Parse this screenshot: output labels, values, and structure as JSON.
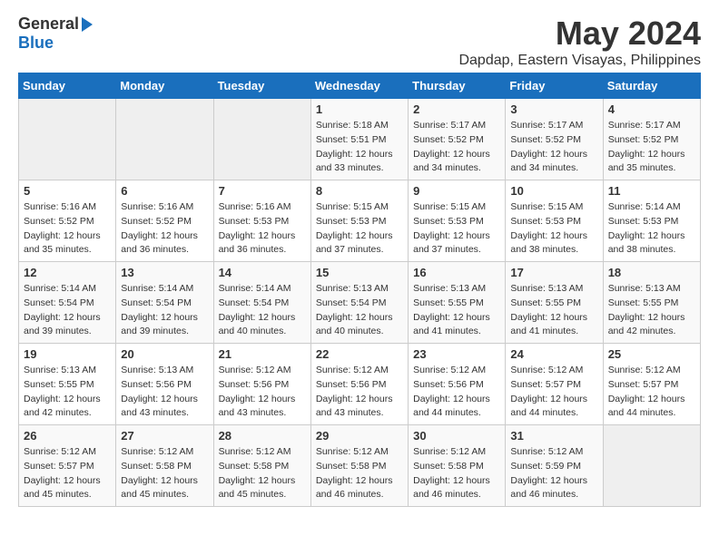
{
  "header": {
    "logo_general": "General",
    "logo_blue": "Blue",
    "title": "May 2024",
    "subtitle": "Dapdap, Eastern Visayas, Philippines"
  },
  "calendar": {
    "weekdays": [
      "Sunday",
      "Monday",
      "Tuesday",
      "Wednesday",
      "Thursday",
      "Friday",
      "Saturday"
    ],
    "weeks": [
      [
        {
          "day": "",
          "empty": true
        },
        {
          "day": "",
          "empty": true
        },
        {
          "day": "",
          "empty": true
        },
        {
          "day": "1",
          "sunrise": "5:18 AM",
          "sunset": "5:51 PM",
          "daylight": "12 hours and 33 minutes."
        },
        {
          "day": "2",
          "sunrise": "5:17 AM",
          "sunset": "5:52 PM",
          "daylight": "12 hours and 34 minutes."
        },
        {
          "day": "3",
          "sunrise": "5:17 AM",
          "sunset": "5:52 PM",
          "daylight": "12 hours and 34 minutes."
        },
        {
          "day": "4",
          "sunrise": "5:17 AM",
          "sunset": "5:52 PM",
          "daylight": "12 hours and 35 minutes."
        }
      ],
      [
        {
          "day": "5",
          "sunrise": "5:16 AM",
          "sunset": "5:52 PM",
          "daylight": "12 hours and 35 minutes."
        },
        {
          "day": "6",
          "sunrise": "5:16 AM",
          "sunset": "5:52 PM",
          "daylight": "12 hours and 36 minutes."
        },
        {
          "day": "7",
          "sunrise": "5:16 AM",
          "sunset": "5:53 PM",
          "daylight": "12 hours and 36 minutes."
        },
        {
          "day": "8",
          "sunrise": "5:15 AM",
          "sunset": "5:53 PM",
          "daylight": "12 hours and 37 minutes."
        },
        {
          "day": "9",
          "sunrise": "5:15 AM",
          "sunset": "5:53 PM",
          "daylight": "12 hours and 37 minutes."
        },
        {
          "day": "10",
          "sunrise": "5:15 AM",
          "sunset": "5:53 PM",
          "daylight": "12 hours and 38 minutes."
        },
        {
          "day": "11",
          "sunrise": "5:14 AM",
          "sunset": "5:53 PM",
          "daylight": "12 hours and 38 minutes."
        }
      ],
      [
        {
          "day": "12",
          "sunrise": "5:14 AM",
          "sunset": "5:54 PM",
          "daylight": "12 hours and 39 minutes."
        },
        {
          "day": "13",
          "sunrise": "5:14 AM",
          "sunset": "5:54 PM",
          "daylight": "12 hours and 39 minutes."
        },
        {
          "day": "14",
          "sunrise": "5:14 AM",
          "sunset": "5:54 PM",
          "daylight": "12 hours and 40 minutes."
        },
        {
          "day": "15",
          "sunrise": "5:13 AM",
          "sunset": "5:54 PM",
          "daylight": "12 hours and 40 minutes."
        },
        {
          "day": "16",
          "sunrise": "5:13 AM",
          "sunset": "5:55 PM",
          "daylight": "12 hours and 41 minutes."
        },
        {
          "day": "17",
          "sunrise": "5:13 AM",
          "sunset": "5:55 PM",
          "daylight": "12 hours and 41 minutes."
        },
        {
          "day": "18",
          "sunrise": "5:13 AM",
          "sunset": "5:55 PM",
          "daylight": "12 hours and 42 minutes."
        }
      ],
      [
        {
          "day": "19",
          "sunrise": "5:13 AM",
          "sunset": "5:55 PM",
          "daylight": "12 hours and 42 minutes."
        },
        {
          "day": "20",
          "sunrise": "5:13 AM",
          "sunset": "5:56 PM",
          "daylight": "12 hours and 43 minutes."
        },
        {
          "day": "21",
          "sunrise": "5:12 AM",
          "sunset": "5:56 PM",
          "daylight": "12 hours and 43 minutes."
        },
        {
          "day": "22",
          "sunrise": "5:12 AM",
          "sunset": "5:56 PM",
          "daylight": "12 hours and 43 minutes."
        },
        {
          "day": "23",
          "sunrise": "5:12 AM",
          "sunset": "5:56 PM",
          "daylight": "12 hours and 44 minutes."
        },
        {
          "day": "24",
          "sunrise": "5:12 AM",
          "sunset": "5:57 PM",
          "daylight": "12 hours and 44 minutes."
        },
        {
          "day": "25",
          "sunrise": "5:12 AM",
          "sunset": "5:57 PM",
          "daylight": "12 hours and 44 minutes."
        }
      ],
      [
        {
          "day": "26",
          "sunrise": "5:12 AM",
          "sunset": "5:57 PM",
          "daylight": "12 hours and 45 minutes."
        },
        {
          "day": "27",
          "sunrise": "5:12 AM",
          "sunset": "5:58 PM",
          "daylight": "12 hours and 45 minutes."
        },
        {
          "day": "28",
          "sunrise": "5:12 AM",
          "sunset": "5:58 PM",
          "daylight": "12 hours and 45 minutes."
        },
        {
          "day": "29",
          "sunrise": "5:12 AM",
          "sunset": "5:58 PM",
          "daylight": "12 hours and 46 minutes."
        },
        {
          "day": "30",
          "sunrise": "5:12 AM",
          "sunset": "5:58 PM",
          "daylight": "12 hours and 46 minutes."
        },
        {
          "day": "31",
          "sunrise": "5:12 AM",
          "sunset": "5:59 PM",
          "daylight": "12 hours and 46 minutes."
        },
        {
          "day": "",
          "empty": true
        }
      ]
    ]
  }
}
